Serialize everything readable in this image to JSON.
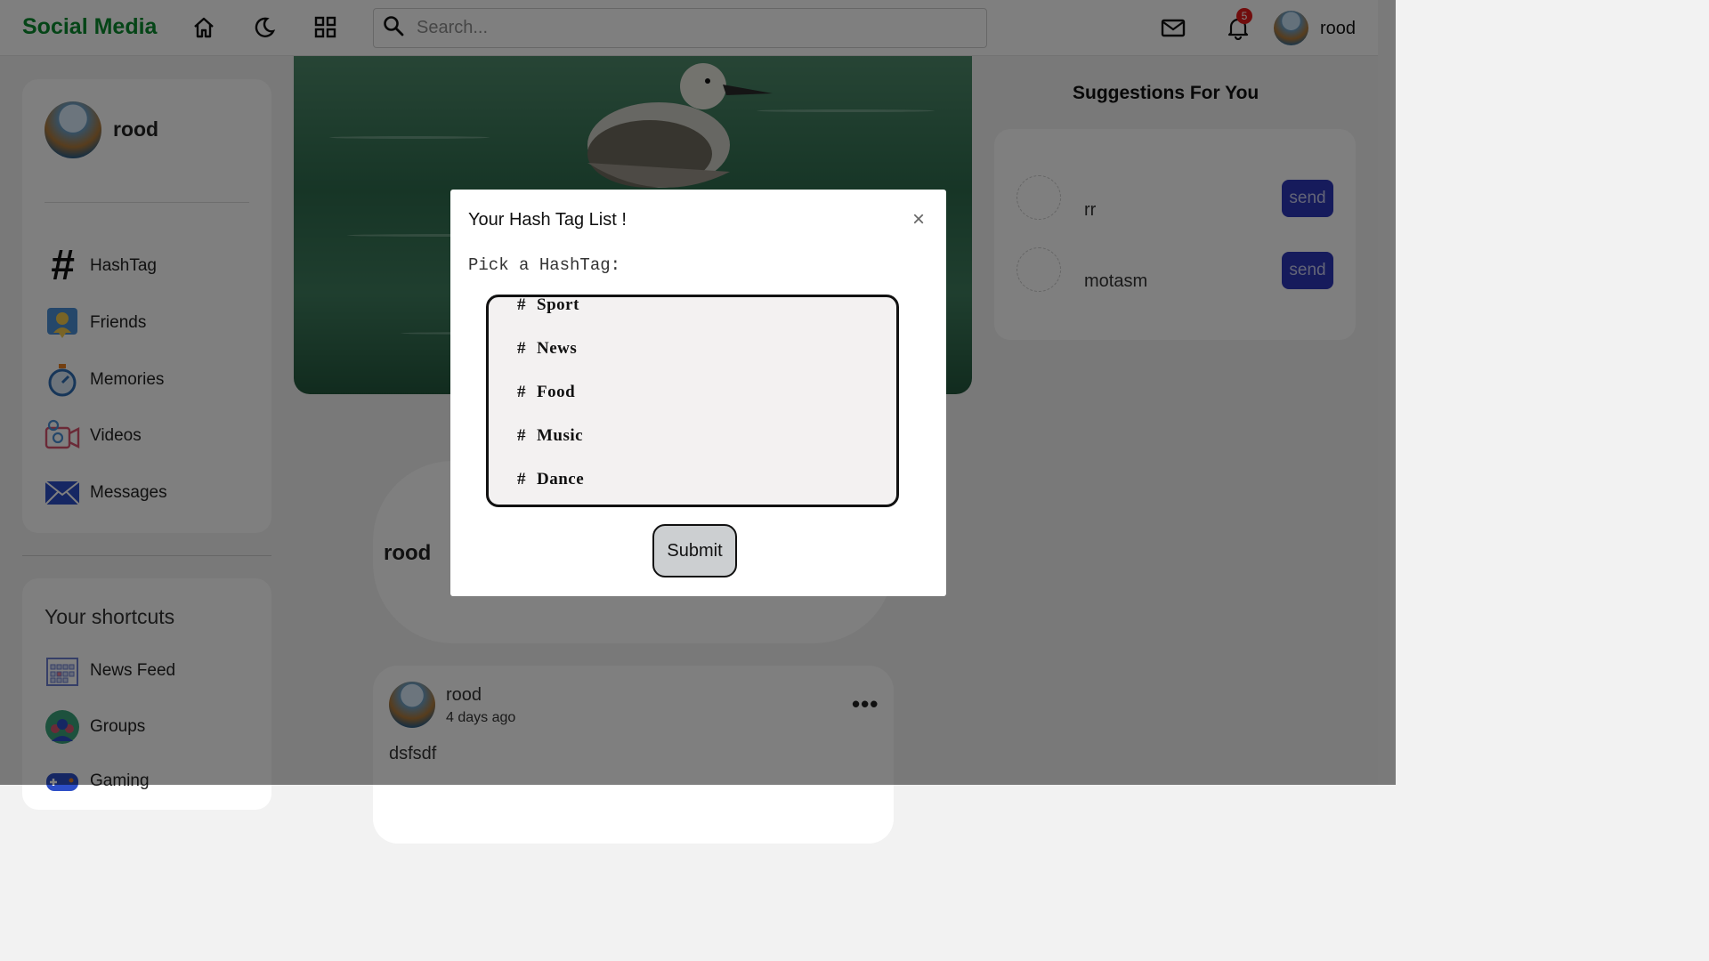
{
  "header": {
    "logo": "Social Media",
    "search_placeholder": "Search...",
    "notification_count": "5",
    "username": "rood"
  },
  "sidebar": {
    "username": "rood",
    "items": [
      {
        "label": "HashTag",
        "icon": "hashtag-icon"
      },
      {
        "label": "Friends",
        "icon": "friends-icon"
      },
      {
        "label": "Memories",
        "icon": "stopwatch-icon"
      },
      {
        "label": "Videos",
        "icon": "video-camera-icon"
      },
      {
        "label": "Messages",
        "icon": "envelope-icon"
      }
    ],
    "shortcuts_title": "Your shortcuts",
    "shortcuts": [
      {
        "label": "News Feed",
        "icon": "calendar-icon"
      },
      {
        "label": "Groups",
        "icon": "groups-icon"
      },
      {
        "label": "Gaming",
        "icon": "gamepad-icon"
      }
    ]
  },
  "story": {
    "username": "rood"
  },
  "post": {
    "username": "rood",
    "time": "4 days ago",
    "text": "dsfsdf",
    "more": "•••"
  },
  "suggestions": {
    "title": "Suggestions For You",
    "users": [
      {
        "name": "rr",
        "button": "send"
      },
      {
        "name": "motasm",
        "button": "send"
      }
    ]
  },
  "modal": {
    "title": "Your Hash Tag List !",
    "close": "×",
    "label": "Pick a HashTag:",
    "tags": [
      "Sport",
      "News",
      "Food",
      "Music",
      "Dance"
    ],
    "hash": "#",
    "submit": "Submit"
  }
}
